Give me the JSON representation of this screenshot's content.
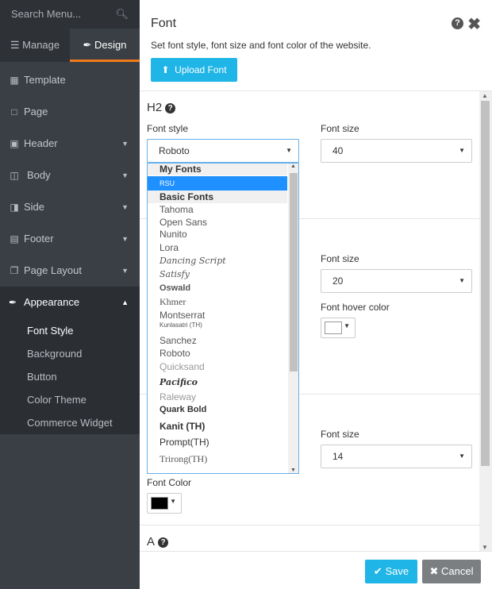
{
  "sidebar": {
    "search_placeholder": "Search Menu...",
    "tabs": {
      "manage": "Manage",
      "design": "Design"
    },
    "items": [
      {
        "label": "Template",
        "icon": "image-icon"
      },
      {
        "label": "Page",
        "icon": "file-icon"
      },
      {
        "label": "Header",
        "icon": "header-icon"
      },
      {
        "label": "Body",
        "icon": "body-icon"
      },
      {
        "label": "Side",
        "icon": "side-icon"
      },
      {
        "label": "Footer",
        "icon": "footer-icon"
      },
      {
        "label": "Page Layout",
        "icon": "layout-icon"
      }
    ],
    "appearance": {
      "label": "Appearance",
      "subitems": [
        "Font Style",
        "Background",
        "Button",
        "Color Theme",
        "Commerce Widget"
      ]
    }
  },
  "main": {
    "title": "Font",
    "description": "Set font style, font size and font color of the website.",
    "upload_label": "Upload Font",
    "h2": {
      "title": "H2",
      "font_style_label": "Font style",
      "font_style_value": "Roboto",
      "font_size_label": "Font size",
      "font_size_value": "40"
    },
    "section2": {
      "font_size_label": "Font size",
      "font_size_value": "20",
      "hover_color_label": "Font hover color"
    },
    "section3": {
      "font_size_label": "Font size",
      "font_size_value": "14",
      "font_color_label": "Font Color"
    },
    "section4_title": "A",
    "dropdown": {
      "group_my": "My Fonts",
      "selected": "RSU",
      "group_basic": "Basic Fonts",
      "fonts": [
        "Tahoma",
        "Open Sans",
        "Nunito",
        "Lora",
        "Dancing Script",
        "Satisfy",
        "Oswald",
        "Khmer",
        "Montserrat",
        "Kunlasatri (TH)",
        "Sanchez",
        "Roboto",
        "Quicksand",
        "Pacifico",
        "Raleway",
        "Quark Bold",
        "Kanit (TH)",
        "Prompt(TH)",
        "Trirong(TH)"
      ]
    }
  },
  "footer": {
    "save": "Save",
    "cancel": "Cancel"
  },
  "colors": {
    "accent": "#1fb5e6",
    "design_tab": "#f07b1a",
    "sidebar_bg": "#3a3f45",
    "selected": "#1e90ff"
  }
}
